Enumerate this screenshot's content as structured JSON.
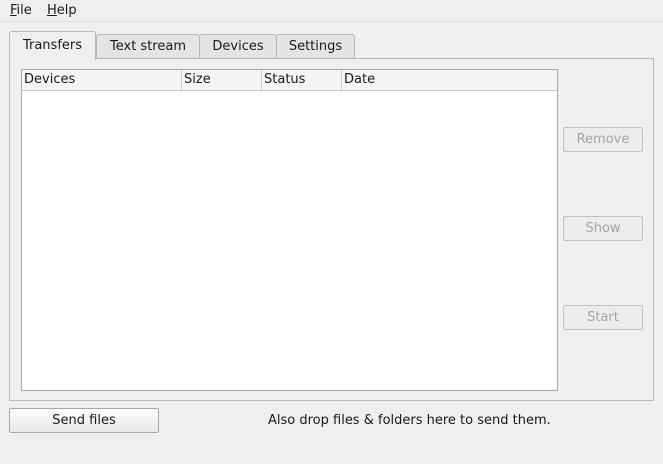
{
  "menubar": {
    "file": {
      "mnemonic": "F",
      "rest": "ile"
    },
    "help": {
      "mnemonic": "H",
      "rest": "elp"
    }
  },
  "tabs": [
    {
      "label": "Transfers",
      "active": true
    },
    {
      "label": "Text stream",
      "active": false
    },
    {
      "label": "Devices",
      "active": false
    },
    {
      "label": "Settings",
      "active": false
    }
  ],
  "transfers": {
    "columns": [
      "Devices",
      "Size",
      "Status",
      "Date"
    ],
    "rows": [],
    "buttons": {
      "remove": "Remove",
      "show": "Show",
      "start": "Start"
    }
  },
  "footer": {
    "send_button": "Send files",
    "hint": "Also drop files & folders here to send them."
  },
  "colors": {
    "window_bg": "#efefef",
    "list_bg": "#ffffff",
    "disabled_text": "#a4a4a4"
  }
}
